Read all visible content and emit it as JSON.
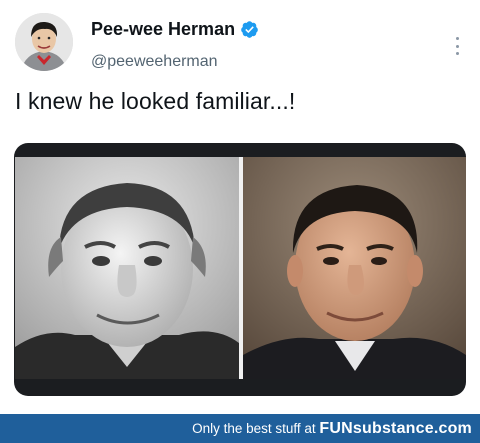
{
  "tweet": {
    "author_name": "Pee-wee Herman",
    "handle": "@peeweeherman",
    "text": "I knew he looked familiar...!",
    "verified": true
  },
  "media": {
    "left_photo": "grandpa-munster-photo",
    "right_photo": "man-in-suit-photo"
  },
  "footer": {
    "tagline": "Only the best stuff at",
    "brand": "FUNsubstance.com"
  },
  "colors": {
    "verified": "#1d9bf0",
    "footer": "#1f5f9b",
    "text": "#0f1419",
    "secondary": "#536471"
  }
}
